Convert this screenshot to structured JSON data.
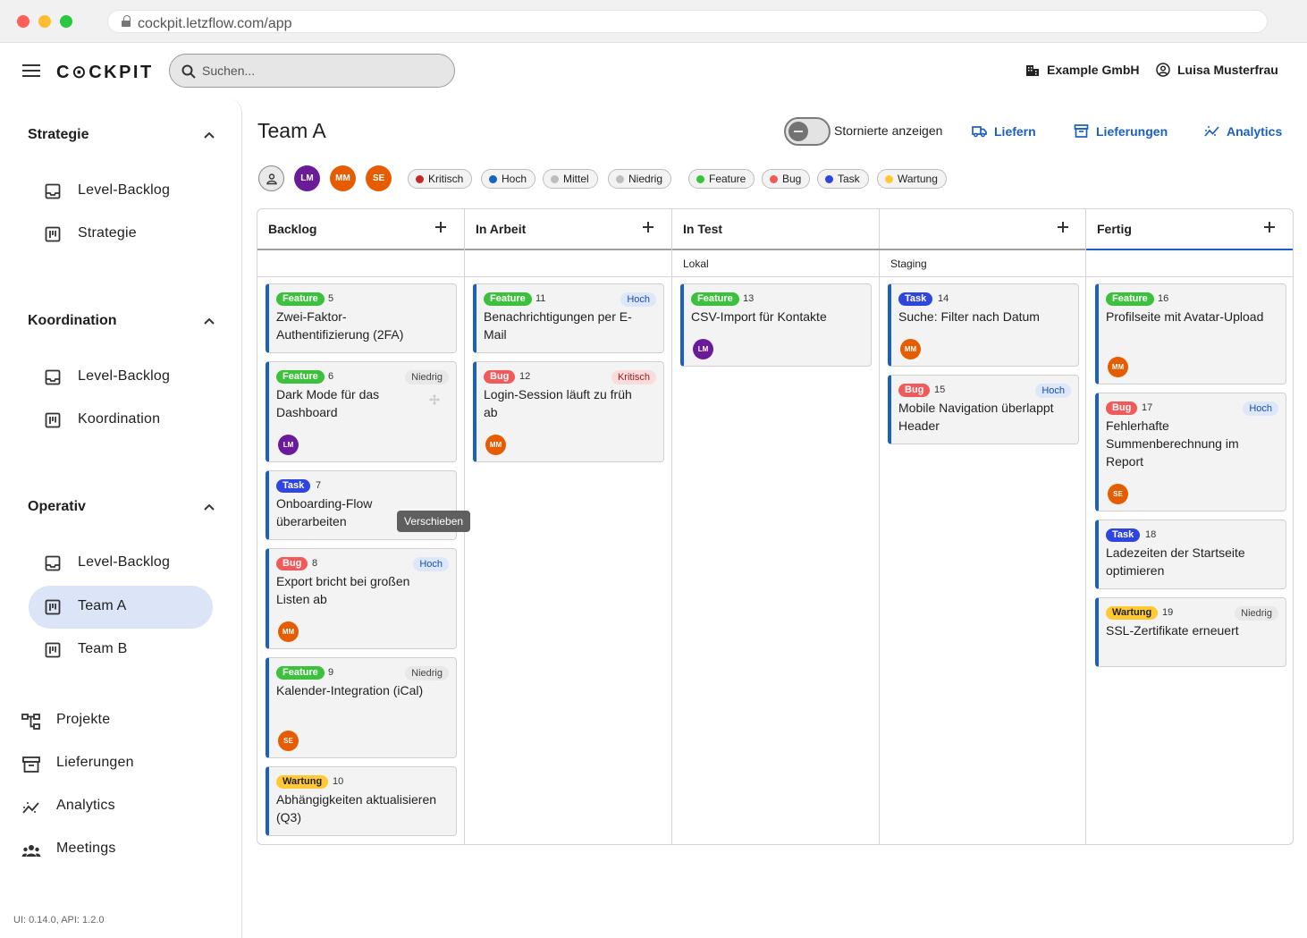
{
  "browser": {
    "url": "cockpit.letzflow.com/app"
  },
  "header": {
    "logo": "C⊙CKPIT",
    "search_placeholder": "Suchen...",
    "company": "Example GmbH",
    "user": "Luisa Musterfrau"
  },
  "sidebar": {
    "sections": [
      {
        "title": "Strategie",
        "items": [
          "Level-Backlog",
          "Strategie"
        ]
      },
      {
        "title": "Koordination",
        "items": [
          "Level-Backlog",
          "Koordination"
        ]
      },
      {
        "title": "Operativ",
        "items": [
          "Level-Backlog",
          "Team A",
          "Team B"
        ]
      }
    ],
    "active_item": "Team A",
    "top_items": [
      "Projekte",
      "Lieferungen",
      "Analytics",
      "Meetings"
    ],
    "version": "UI: 0.14.0, API: 1.2.0"
  },
  "page": {
    "title": "Team A",
    "toggle_label": "Stornierte anzeigen",
    "toggle_on": false,
    "actions": [
      "Liefern",
      "Lieferungen",
      "Analytics"
    ]
  },
  "filters": {
    "avatars": [
      {
        "initials": "LM",
        "color": "#6a1b9a"
      },
      {
        "initials": "MM",
        "color": "#e65c00"
      },
      {
        "initials": "SE",
        "color": "#e65c00"
      }
    ],
    "priorities": [
      {
        "label": "Kritisch",
        "color": "#c62828"
      },
      {
        "label": "Hoch",
        "color": "#1565c0"
      },
      {
        "label": "Mittel",
        "color": "#bdbdbd"
      },
      {
        "label": "Niedrig",
        "color": "#bdbdbd"
      }
    ],
    "types": [
      {
        "label": "Feature",
        "color": "#3bc13b"
      },
      {
        "label": "Bug",
        "color": "#f05a5a"
      },
      {
        "label": "Task",
        "color": "#2f45e0"
      },
      {
        "label": "Wartung",
        "color": "#ffc933"
      }
    ]
  },
  "board": {
    "columns": [
      {
        "title": "Backlog"
      },
      {
        "title": "In Arbeit"
      },
      {
        "title": "In Test",
        "subcolumns": [
          "Lokal",
          "Staging"
        ]
      },
      {
        "title": "Fertig"
      }
    ],
    "cards": [
      {
        "type": "Feature",
        "number": "5",
        "title": "Zwei-Faktor-Authentifizierung (2FA)",
        "priority": "",
        "assignee": ""
      },
      {
        "type": "Feature",
        "number": "6",
        "title": "Dark Mode für das Dashboard",
        "priority": "Niedrig",
        "assignee": "LM"
      },
      {
        "type": "Task",
        "number": "7",
        "title": "Onboarding-Flow überarbeiten",
        "priority": "",
        "assignee": ""
      },
      {
        "type": "Bug",
        "number": "8",
        "title": "Export bricht bei großen Listen ab",
        "priority": "Hoch",
        "assignee": "MM"
      },
      {
        "type": "Feature",
        "number": "9",
        "title": "Kalender-Integration (iCal)",
        "priority": "Niedrig",
        "assignee": "SE"
      },
      {
        "type": "Wartung",
        "number": "10",
        "title": "Abhängigkeiten aktualisieren (Q3)",
        "priority": "",
        "assignee": ""
      },
      {
        "type": "Feature",
        "number": "11",
        "title": "Benachrichtigungen per E-Mail",
        "priority": "Hoch",
        "assignee": ""
      },
      {
        "type": "Bug",
        "number": "12",
        "title": "Login-Session läuft zu früh ab",
        "priority": "Kritisch",
        "assignee": "MM"
      },
      {
        "type": "Feature",
        "number": "13",
        "title": "CSV-Import für Kontakte",
        "priority": "",
        "assignee": "LM"
      },
      {
        "type": "Task",
        "number": "14",
        "title": "Suche: Filter nach Datum",
        "priority": "",
        "assignee": "MM"
      },
      {
        "type": "Bug",
        "number": "15",
        "title": "Mobile Navigation überlappt Header",
        "priority": "Hoch",
        "assignee": ""
      },
      {
        "type": "Feature",
        "number": "16",
        "title": "Profilseite mit Avatar-Upload",
        "priority": "",
        "assignee": "MM"
      },
      {
        "type": "Bug",
        "number": "17",
        "title": "Fehlerhafte Summenberechnung im Report",
        "priority": "Hoch",
        "assignee": "SE"
      },
      {
        "type": "Task",
        "number": "18",
        "title": "Ladezeiten der Startseite optimieren",
        "priority": "",
        "assignee": ""
      },
      {
        "type": "Wartung",
        "number": "19",
        "title": "SSL-Zertifikate erneuert",
        "priority": "Niedrig",
        "assignee": ""
      }
    ]
  },
  "tooltip": "Verschieben"
}
